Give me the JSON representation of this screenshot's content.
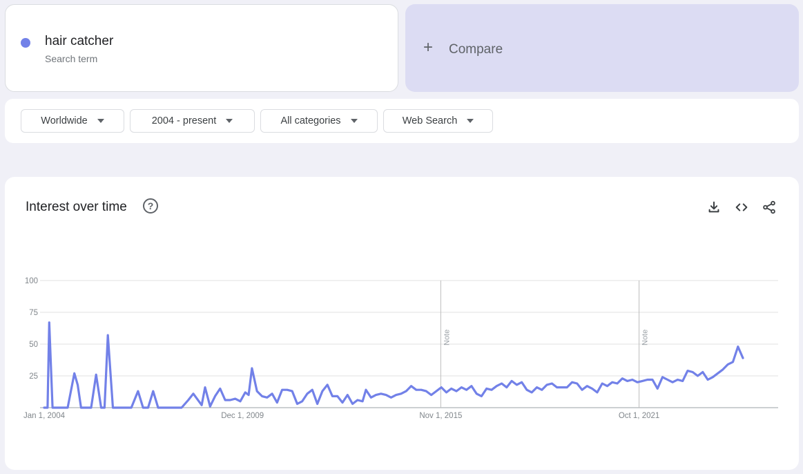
{
  "search_term": {
    "name": "hair catcher",
    "subtitle": "Search term",
    "color": "#7281e8"
  },
  "compare": {
    "label": "Compare",
    "icon": "plus-icon"
  },
  "filters": {
    "region": "Worldwide",
    "time_range": "2004 - present",
    "category": "All categories",
    "search_type": "Web Search"
  },
  "chart_card": {
    "title": "Interest over time",
    "help_icon": "help-circle-icon",
    "actions": [
      "download-icon",
      "embed-code-icon",
      "share-icon"
    ]
  },
  "chart_data": {
    "type": "line",
    "title": "Interest over time",
    "ylim": [
      0,
      100
    ],
    "yticks": [
      100,
      75,
      50,
      25
    ],
    "xtick_labels": [
      {
        "label": "Jan 1, 2004",
        "t": 2004.0
      },
      {
        "label": "Dec 1, 2009",
        "t": 2009.917
      },
      {
        "label": "Nov 1, 2015",
        "t": 2015.833
      },
      {
        "label": "Oct 1, 2021",
        "t": 2021.75
      }
    ],
    "x_start": 2004.0,
    "x_end": 2025.9,
    "notes": [
      {
        "label": "Note",
        "t": 2015.833
      },
      {
        "label": "Note",
        "t": 2021.75
      }
    ],
    "series": [
      {
        "color": "#7281e8",
        "points": [
          [
            2004.0,
            0
          ],
          [
            2004.1,
            0
          ],
          [
            2004.15,
            67
          ],
          [
            2004.25,
            0
          ],
          [
            2004.4,
            0
          ],
          [
            2004.6,
            0
          ],
          [
            2004.7,
            0
          ],
          [
            2004.9,
            27
          ],
          [
            2005.0,
            18
          ],
          [
            2005.1,
            0
          ],
          [
            2005.3,
            0
          ],
          [
            2005.4,
            0
          ],
          [
            2005.55,
            26
          ],
          [
            2005.7,
            0
          ],
          [
            2005.8,
            0
          ],
          [
            2005.9,
            57
          ],
          [
            2006.05,
            0
          ],
          [
            2006.2,
            0
          ],
          [
            2006.4,
            0
          ],
          [
            2006.6,
            0
          ],
          [
            2006.8,
            13
          ],
          [
            2006.95,
            0
          ],
          [
            2007.1,
            0
          ],
          [
            2007.25,
            13
          ],
          [
            2007.4,
            0
          ],
          [
            2007.6,
            0
          ],
          [
            2007.9,
            0
          ],
          [
            2008.1,
            0
          ],
          [
            2008.3,
            6
          ],
          [
            2008.45,
            11
          ],
          [
            2008.7,
            2
          ],
          [
            2008.8,
            16
          ],
          [
            2008.95,
            1
          ],
          [
            2009.1,
            9
          ],
          [
            2009.25,
            15
          ],
          [
            2009.4,
            6
          ],
          [
            2009.55,
            6
          ],
          [
            2009.7,
            7
          ],
          [
            2009.85,
            5
          ],
          [
            2010.0,
            12
          ],
          [
            2010.1,
            10
          ],
          [
            2010.2,
            31
          ],
          [
            2010.35,
            13
          ],
          [
            2010.5,
            9
          ],
          [
            2010.65,
            8
          ],
          [
            2010.8,
            11
          ],
          [
            2010.95,
            4
          ],
          [
            2011.1,
            14
          ],
          [
            2011.25,
            14
          ],
          [
            2011.4,
            13
          ],
          [
            2011.55,
            3
          ],
          [
            2011.7,
            5
          ],
          [
            2011.85,
            11
          ],
          [
            2012.0,
            14
          ],
          [
            2012.15,
            3
          ],
          [
            2012.3,
            13
          ],
          [
            2012.45,
            18
          ],
          [
            2012.6,
            9
          ],
          [
            2012.75,
            9
          ],
          [
            2012.9,
            4
          ],
          [
            2013.05,
            10
          ],
          [
            2013.2,
            3
          ],
          [
            2013.35,
            6
          ],
          [
            2013.5,
            5
          ],
          [
            2013.6,
            14
          ],
          [
            2013.75,
            8
          ],
          [
            2013.9,
            10
          ],
          [
            2014.05,
            11
          ],
          [
            2014.2,
            10
          ],
          [
            2014.35,
            8
          ],
          [
            2014.5,
            10
          ],
          [
            2014.65,
            11
          ],
          [
            2014.8,
            13
          ],
          [
            2014.95,
            17
          ],
          [
            2015.1,
            14
          ],
          [
            2015.25,
            14
          ],
          [
            2015.4,
            13
          ],
          [
            2015.55,
            10
          ],
          [
            2015.7,
            13
          ],
          [
            2015.85,
            16
          ],
          [
            2016.0,
            12
          ],
          [
            2016.15,
            15
          ],
          [
            2016.3,
            13
          ],
          [
            2016.45,
            16
          ],
          [
            2016.6,
            14
          ],
          [
            2016.75,
            17
          ],
          [
            2016.9,
            11
          ],
          [
            2017.05,
            9
          ],
          [
            2017.2,
            15
          ],
          [
            2017.35,
            14
          ],
          [
            2017.5,
            17
          ],
          [
            2017.65,
            19
          ],
          [
            2017.8,
            16
          ],
          [
            2017.95,
            21
          ],
          [
            2018.1,
            18
          ],
          [
            2018.25,
            20
          ],
          [
            2018.4,
            14
          ],
          [
            2018.55,
            12
          ],
          [
            2018.7,
            16
          ],
          [
            2018.85,
            14
          ],
          [
            2019.0,
            18
          ],
          [
            2019.15,
            19
          ],
          [
            2019.3,
            16
          ],
          [
            2019.45,
            16
          ],
          [
            2019.6,
            16
          ],
          [
            2019.75,
            20
          ],
          [
            2019.9,
            19
          ],
          [
            2020.05,
            14
          ],
          [
            2020.2,
            17
          ],
          [
            2020.35,
            15
          ],
          [
            2020.5,
            12
          ],
          [
            2020.65,
            19
          ],
          [
            2020.8,
            17
          ],
          [
            2020.95,
            20
          ],
          [
            2021.1,
            19
          ],
          [
            2021.25,
            23
          ],
          [
            2021.4,
            21
          ],
          [
            2021.55,
            22
          ],
          [
            2021.7,
            20
          ],
          [
            2021.85,
            21
          ],
          [
            2022.0,
            22
          ],
          [
            2022.15,
            22
          ],
          [
            2022.3,
            15
          ],
          [
            2022.45,
            24
          ],
          [
            2022.6,
            22
          ],
          [
            2022.75,
            20
          ],
          [
            2022.9,
            22
          ],
          [
            2023.05,
            21
          ],
          [
            2023.2,
            29
          ],
          [
            2023.35,
            28
          ],
          [
            2023.5,
            25
          ],
          [
            2023.65,
            28
          ],
          [
            2023.8,
            22
          ],
          [
            2023.95,
            24
          ],
          [
            2024.1,
            27
          ],
          [
            2024.25,
            30
          ],
          [
            2024.4,
            34
          ],
          [
            2024.55,
            36
          ],
          [
            2024.7,
            48
          ],
          [
            2024.85,
            39
          ]
        ]
      }
    ]
  }
}
